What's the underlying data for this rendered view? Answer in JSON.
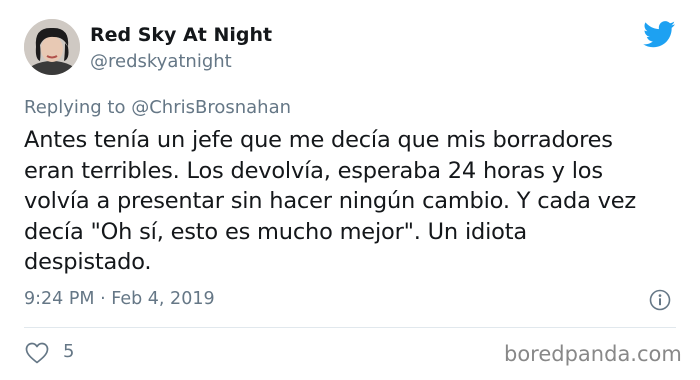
{
  "author": {
    "display_name": "Red Sky At Night",
    "handle": "@redskyatnight",
    "avatar_icon": "profile-photo"
  },
  "reply": {
    "prefix": "Replying to",
    "mention": "@ChrisBrosnahan"
  },
  "tweet": {
    "lines": [
      "Antes tenía un jefe que me decía que mis borradores",
      "eran terribles. Los devolvía, esperaba 24 horas y los",
      "volvía a presentar sin hacer ningún cambio. Y cada vez",
      "decía \"Oh sí, esto es mucho mejor\". Un idiota",
      "despistado."
    ]
  },
  "meta": {
    "time": "9:24 PM",
    "separator": "·",
    "date": "Feb 4, 2019"
  },
  "actions": {
    "like_count": "5"
  },
  "watermark": "boredpanda.com",
  "colors": {
    "twitter_blue": "#1da1f2",
    "secondary_text": "#657786",
    "primary_text": "#14171a",
    "divider": "#e1e8ed"
  }
}
